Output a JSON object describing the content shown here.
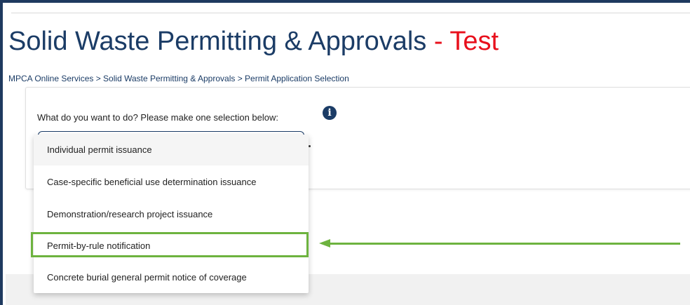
{
  "page": {
    "title": "Solid Waste Permitting & Approvals",
    "title_separator": " - ",
    "environment_label": "Test",
    "environment_color": "#e8101c",
    "title_color": "#1b3c66"
  },
  "breadcrumb": {
    "text": "MPCA Online Services > Solid Waste Permitting & Approvals > Permit Application Selection"
  },
  "form": {
    "question": "What do you want to do? Please make one selection below:",
    "info_icon": "info-icon",
    "options": [
      "Individual permit issuance",
      "Case-specific beneficial use determination issuance",
      "Demonstration/research project issuance",
      "Permit-by-rule notification",
      "Concrete burial general permit notice of coverage"
    ],
    "hovered_option": "Individual permit issuance"
  },
  "annotation": {
    "highlighted_option": "Permit-by-rule notification",
    "highlight_color": "#6db33f"
  }
}
